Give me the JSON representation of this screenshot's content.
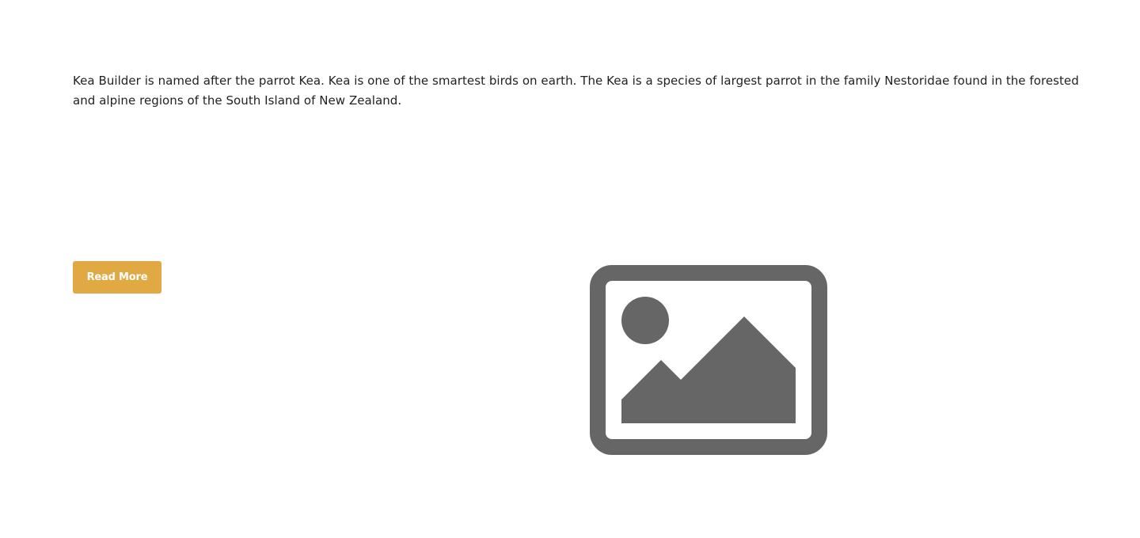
{
  "content": {
    "intro_text": "Kea Builder is named after the parrot Kea. Kea is one of the smartest birds on earth. The Kea is a species of largest parrot in the family Nestoridae found in the forested and alpine regions of the South Island of New Zealand."
  },
  "actions": {
    "read_more_label": "Read More"
  },
  "media": {
    "placeholder_icon": "image-icon"
  },
  "colors": {
    "accent": "#e0a943",
    "button_text": "#ffffff",
    "body_text": "#222222",
    "placeholder_icon": "#666666",
    "background": "#ffffff"
  }
}
